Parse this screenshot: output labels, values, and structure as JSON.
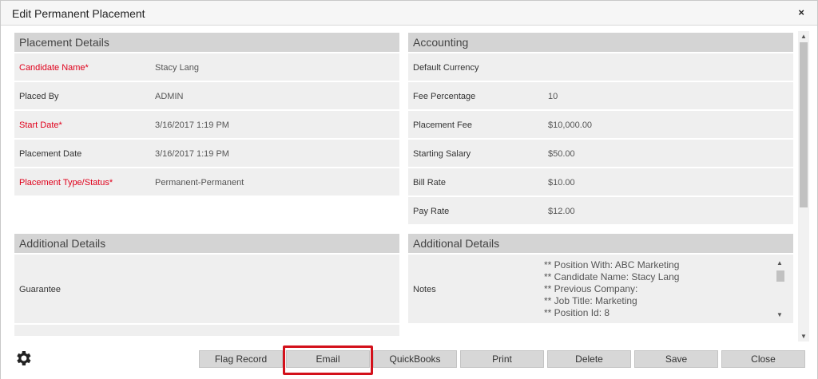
{
  "dialog": {
    "title": "Edit Permanent Placement",
    "close_glyph": "×"
  },
  "placement_details": {
    "header": "Placement Details",
    "rows": [
      {
        "label": "Candidate Name*",
        "value": "Stacy Lang",
        "required": true
      },
      {
        "label": "Placed By",
        "value": "ADMIN",
        "required": false
      },
      {
        "label": "Start Date*",
        "value": "3/16/2017 1:19 PM",
        "required": true
      },
      {
        "label": "Placement Date",
        "value": "3/16/2017 1:19 PM",
        "required": false
      },
      {
        "label": "Placement Type/Status*",
        "value": "Permanent-Permanent",
        "required": true
      }
    ]
  },
  "accounting": {
    "header": "Accounting",
    "rows": [
      {
        "label": "Default Currency",
        "value": ""
      },
      {
        "label": "Fee Percentage",
        "value": "10"
      },
      {
        "label": "Placement Fee",
        "value": "$10,000.00"
      },
      {
        "label": "Starting Salary",
        "value": "$50.00"
      },
      {
        "label": "Bill Rate",
        "value": "$10.00"
      },
      {
        "label": "Pay Rate",
        "value": "$12.00"
      }
    ]
  },
  "additional_left": {
    "header": "Additional Details",
    "guarantee_label": "Guarantee"
  },
  "additional_right": {
    "header": "Additional Details",
    "notes_label": "Notes",
    "notes_lines": [
      "** Position With: ABC Marketing",
      "** Candidate Name: Stacy Lang",
      "** Previous Company:",
      "** Job Title: Marketing",
      "** Position Id: 8"
    ]
  },
  "footer": {
    "buttons": [
      "Flag Record",
      "Email",
      "QuickBooks",
      "Print",
      "Delete",
      "Save",
      "Close"
    ],
    "highlighted_button": "Email",
    "highlight_color": "#d3111b",
    "settings_icon": "gear-icon"
  },
  "colors": {
    "required_label": "#e0001b",
    "section_header": "#d4d4d4",
    "row_bg": "#efefef"
  }
}
